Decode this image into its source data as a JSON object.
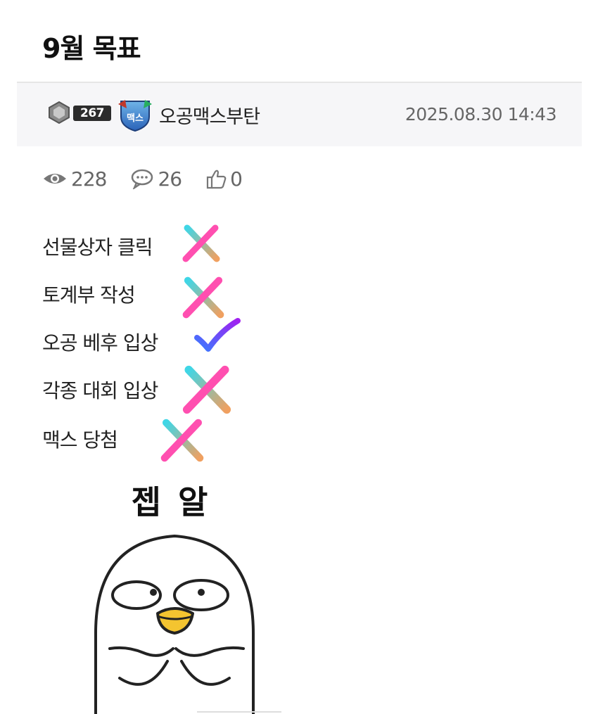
{
  "post": {
    "title": "9월 목표"
  },
  "author": {
    "level": "267",
    "emblem_text": "맥스",
    "name": "오공맥스부탄",
    "date": "2025.08.30 14:43"
  },
  "stats": {
    "views": "228",
    "comments": "26",
    "likes": "0"
  },
  "goals": [
    {
      "text": "선물상자 클릭",
      "status": "x-mark"
    },
    {
      "text": "토계부 작성",
      "status": "x-mark"
    },
    {
      "text": "오공 베후 입상",
      "status": "check-mark"
    },
    {
      "text": "각종 대회 입상",
      "status": "x-mark"
    },
    {
      "text": "맥스 당첨",
      "status": "x-mark"
    }
  ],
  "sticker": {
    "caption": "젭 알"
  },
  "colors": {
    "x_start": "#3fd6e6",
    "x_end": "#ff4fb0",
    "x_end2": "#f0a060",
    "check_start": "#3a7bff",
    "check_end": "#a020f0",
    "beak": "#f4c430"
  }
}
